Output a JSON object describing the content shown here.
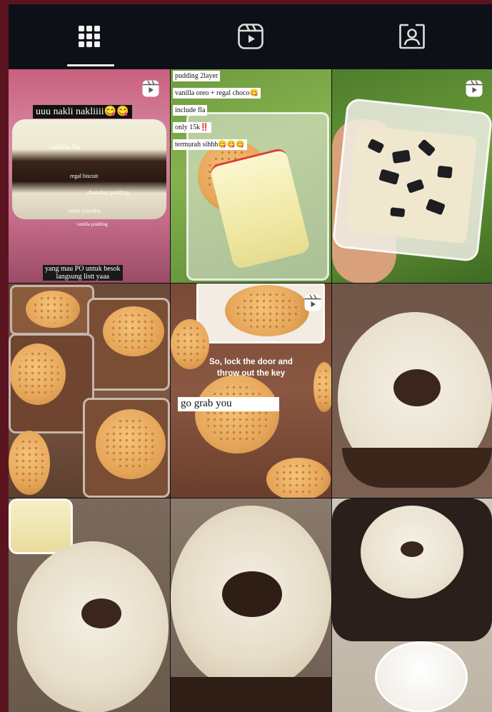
{
  "tabs": [
    {
      "name": "grid",
      "icon": "grid-icon",
      "active": true
    },
    {
      "name": "reels",
      "icon": "reels-icon",
      "active": false
    },
    {
      "name": "tagged",
      "icon": "tagged-icon",
      "active": false
    }
  ],
  "posts": [
    {
      "type": "reel",
      "title": "uuu nakli nakliiii😋😋",
      "labels": [
        "vanilla fla",
        "regal biscuit",
        "chocolate pudding",
        "oreo crumbs",
        "vanilla pudding"
      ],
      "footer_line1": "yang mau PO untuk besok",
      "footer_line2": "langsung listt yaaa"
    },
    {
      "type": "photo",
      "lines": [
        "pudding 2layer",
        "vanilla oreo + regal choco😋",
        "include fla",
        "only 15k‼️",
        "termurah sihhh😋😋😋"
      ]
    },
    {
      "type": "reel"
    },
    {
      "type": "photo"
    },
    {
      "type": "reel",
      "overlay_line1": "So, lock the door and",
      "overlay_line2": "throw out the key",
      "caption": "go grab you"
    },
    {
      "type": "photo"
    },
    {
      "type": "photo"
    },
    {
      "type": "photo"
    },
    {
      "type": "photo"
    }
  ],
  "colors": {
    "background": "#0d1117",
    "outer": "#5a1420",
    "icon": "#e8e8e8"
  }
}
